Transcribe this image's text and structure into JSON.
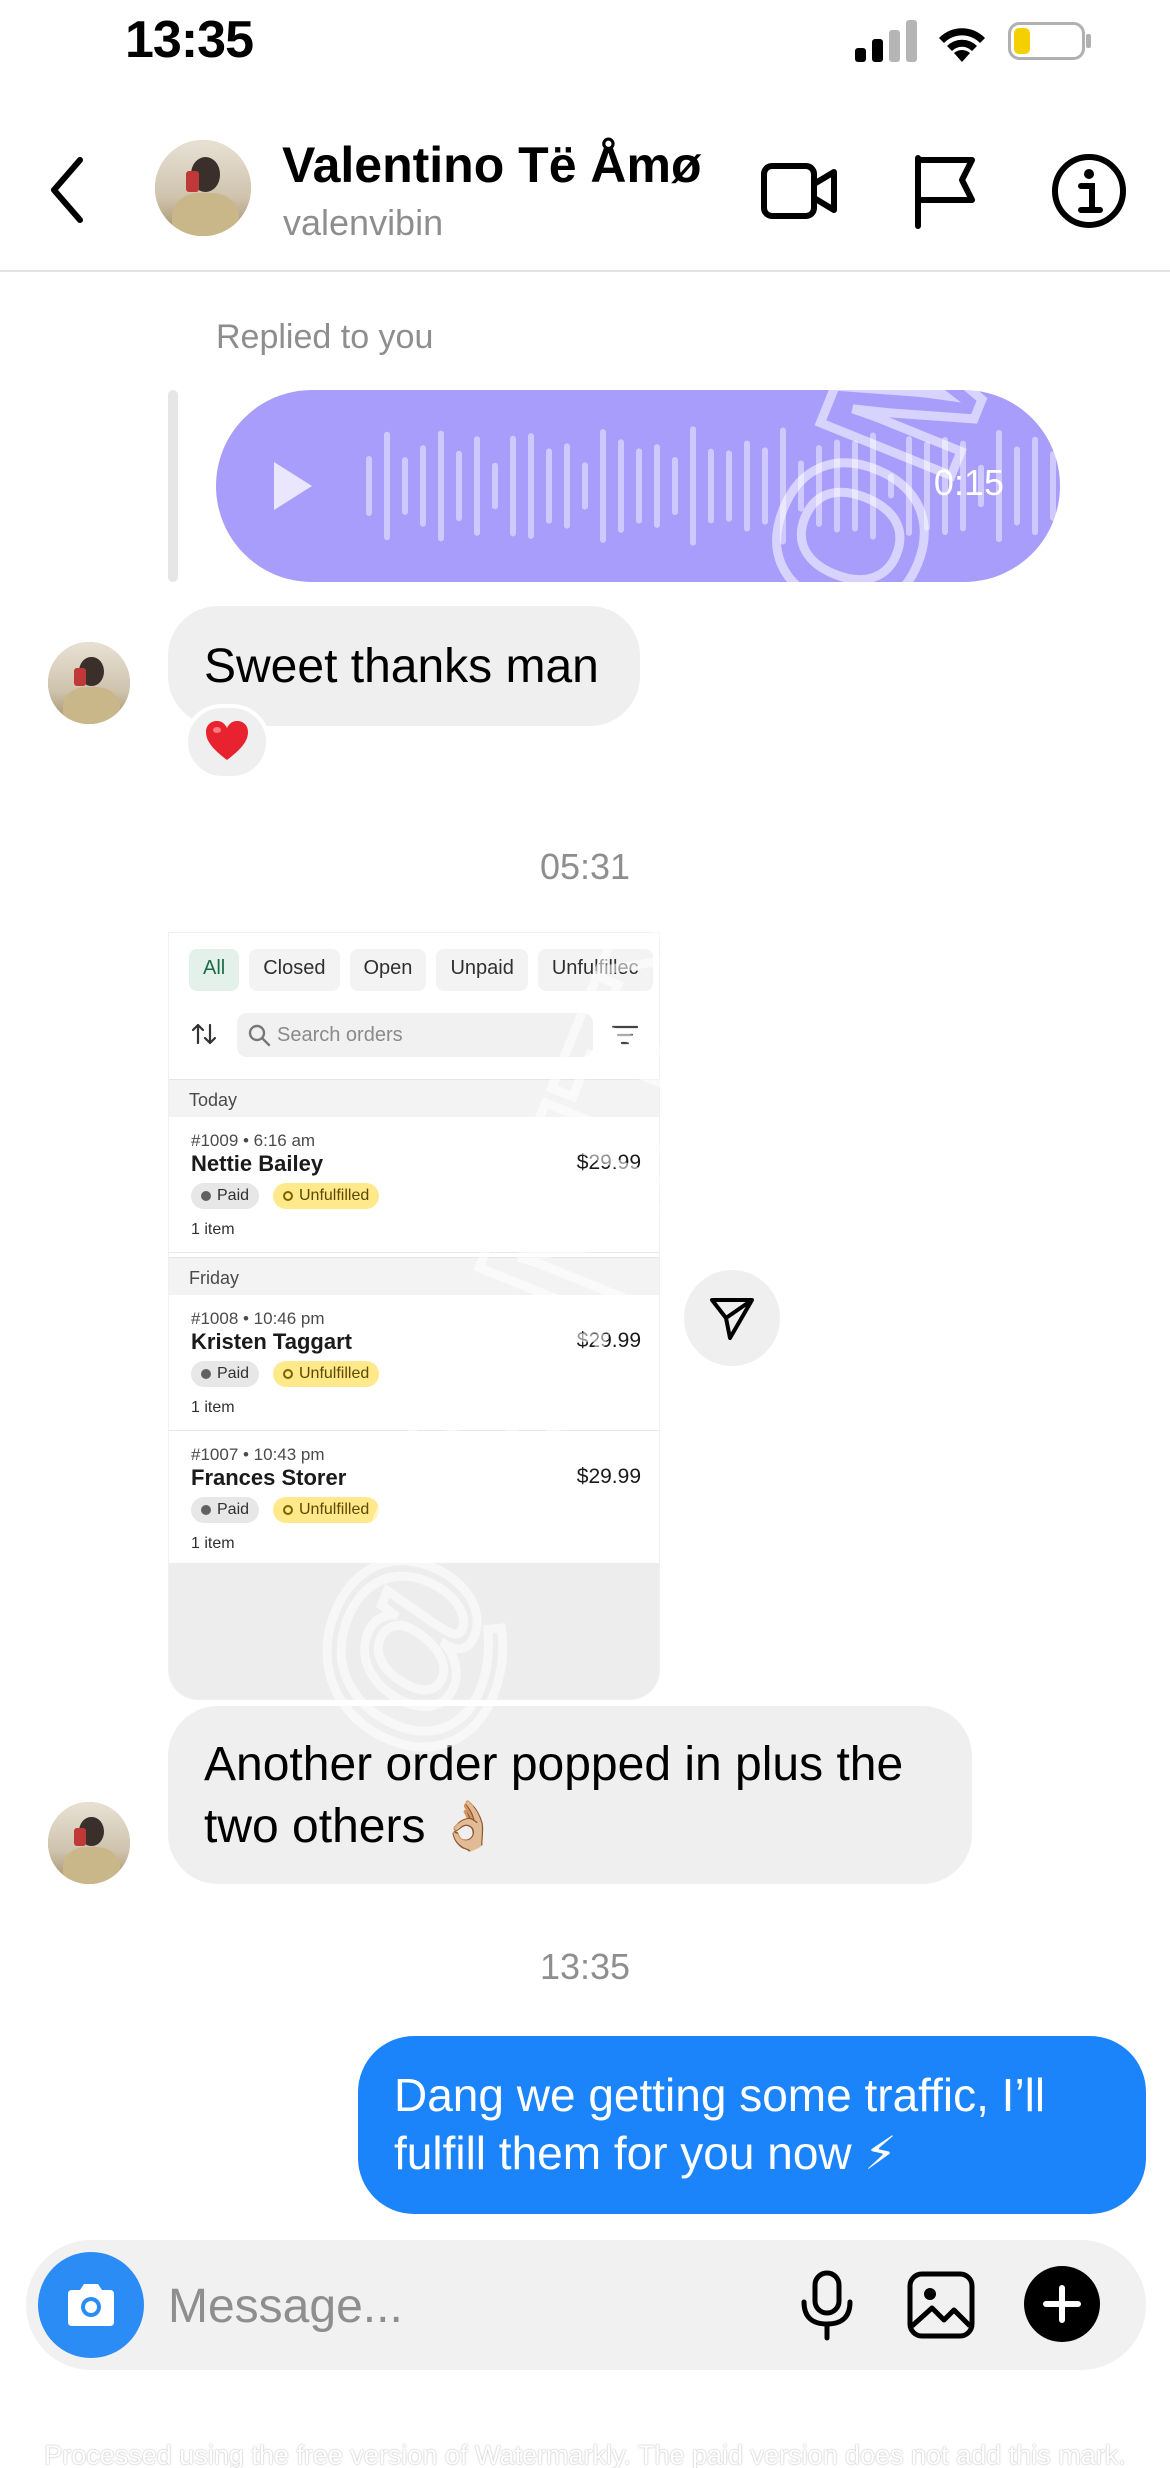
{
  "status_bar": {
    "time": "13:35"
  },
  "header": {
    "contact_name": "Valentino Të Åmø",
    "contact_username": "valenvibin"
  },
  "chat": {
    "reply_label": "Replied to you",
    "voice_message": {
      "duration": "0:15"
    },
    "message_1": {
      "text": "Sweet thanks man",
      "reaction": "heart"
    },
    "timestamp_1": "05:31",
    "shared_screenshot": {
      "tabs": [
        "All",
        "Closed",
        "Open",
        "Unpaid",
        "Unfulfillec"
      ],
      "search_placeholder": "Search orders",
      "sections": [
        {
          "label": "Today",
          "orders": [
            {
              "meta": "#1009 • 6:16 am",
              "name": "Nettie Bailey",
              "price": "$29.99",
              "paid": "Paid",
              "status": "Unfulfilled",
              "items": "1 item"
            }
          ]
        },
        {
          "label": "Friday",
          "orders": [
            {
              "meta": "#1008 • 10:46 pm",
              "name": "Kristen Taggart",
              "price": "$29.99",
              "paid": "Paid",
              "status": "Unfulfilled",
              "items": "1 item"
            },
            {
              "meta": "#1007 • 10:43 pm",
              "name": "Frances Storer",
              "price": "$29.99",
              "paid": "Paid",
              "status": "Unfulfilled",
              "items": "1 item"
            }
          ]
        }
      ]
    },
    "message_2": {
      "line1": "Another order popped in plus the",
      "line2": "two others 👌🏼"
    },
    "timestamp_2": "13:35",
    "message_3": {
      "line1": "Dang we getting some traffic, I’ll",
      "line2": "fulfill them for you now ⚡"
    }
  },
  "composer": {
    "placeholder": "Message..."
  },
  "watermark": {
    "overlay_text": "@VANITYECOM",
    "footer_text": "Processed using the free version of Watermarkly. The paid version does not add this mark."
  },
  "colors": {
    "voice_bubble": "#a99dfb",
    "outgoing_bubble": "#1c84fb",
    "camera_button": "#2c8cf6",
    "incoming_bubble": "#efefef"
  },
  "icons": [
    "back-arrow-icon",
    "video-call-icon",
    "flag-icon",
    "info-icon",
    "play-icon",
    "heart-icon",
    "share-icon",
    "camera-icon",
    "microphone-icon",
    "gallery-icon",
    "plus-icon",
    "search-icon",
    "sort-icon",
    "filter-icon"
  ]
}
